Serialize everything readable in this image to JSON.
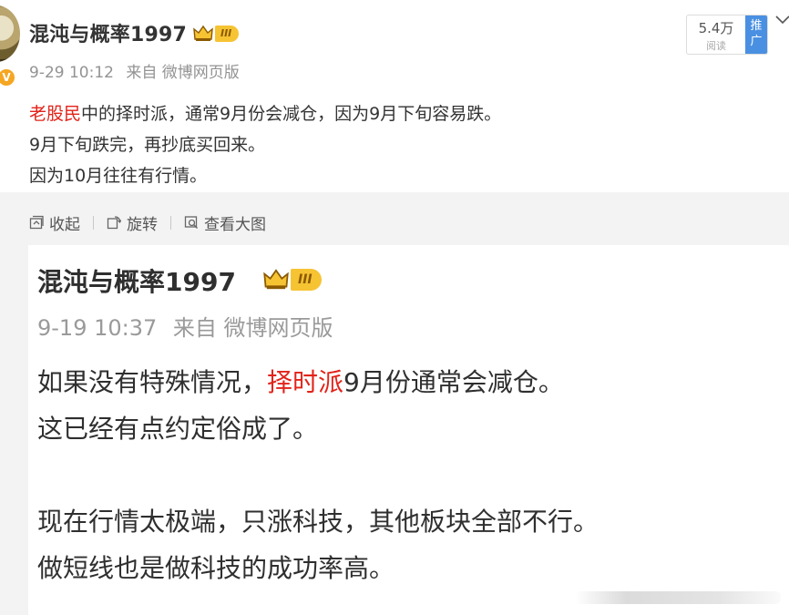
{
  "post": {
    "author": "混沌与概率1997",
    "level_badge": "III",
    "date": "9-29 10:12",
    "source_prefix": "来自",
    "source": "微博网页版",
    "text": {
      "line1_highlight": "老股民",
      "line1_rest": "中的择时派，通常9月份会减仓，因为9月下旬容易跌。",
      "line2": "9月下旬跌完，再抄底买回来。",
      "line3": "因为10月往往有行情。"
    },
    "read_count": "5.4万",
    "read_label": "阅读",
    "promote_label": "推广"
  },
  "toolbar": {
    "collapse_label": "收起",
    "rotate_label": "旋转",
    "view_large_label": "查看大图"
  },
  "image_post": {
    "author": "混沌与概率1997",
    "level_badge": "III",
    "date": "9-19 10:37",
    "source_prefix": "来自",
    "source": "微博网页版",
    "line1_before": "如果没有特殊情况，",
    "line1_highlight": "择时派",
    "line1_after": "9月份通常会减仓。",
    "line2": "这已经有点约定俗成了。",
    "line3": "现在行情太极端，只涨科技，其他板块全部不行。",
    "line4": "做短线也是做科技的成功率高。"
  },
  "colors": {
    "highlight": "#e2231a",
    "accent_blue": "#4a90e2",
    "badge_gold": "#f6c333"
  }
}
